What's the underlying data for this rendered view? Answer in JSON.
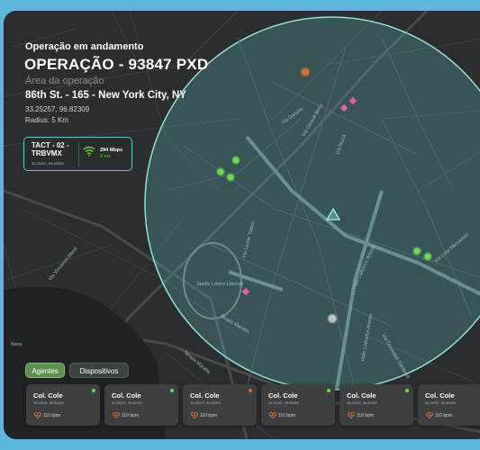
{
  "header": {
    "status": "Operação em andamento",
    "title": "OPERAÇÃO - 93847 PXD",
    "area_label": "Área da operação",
    "address": "86th St. - 165 - New York City, NY",
    "coordinates": "33.25257, 96.82309",
    "radius": "Radius: 5 Km"
  },
  "device": {
    "name": "TACT - 02 - TRBVMX",
    "coordinates": "33.25257, 96.82309",
    "speed": "294 Mbps",
    "ping": "3 ms",
    "icon": "wifi-icon"
  },
  "map": {
    "streets": [
      "Via Daniele",
      "Via Giosuè Borsi",
      "Via Nizza",
      "Via Leone Tolstoi",
      "Stadio Libero Liberati",
      "Strada Maratta",
      "Via Vincenzo Monti",
      "Viale Ludovico Ariosto",
      "Via Luigi Mercantini",
      "Via Giuseppe Garibaldi",
      "Strada Maratta",
      "Viale Ludovico Ariosto",
      "Nera"
    ],
    "colors": {
      "area": "#5fc6c4",
      "online": "#6bdb4d",
      "alert": "#e06a2a",
      "poi": "#e75ea8"
    }
  },
  "tabs": [
    {
      "label": "Agentes",
      "active": true
    },
    {
      "label": "Dispositivos",
      "active": false
    }
  ],
  "agents": [
    {
      "name": "Col. Cole",
      "coordinates": "33.25257, 96.82309",
      "bpm": "110 bpm",
      "status": "online"
    },
    {
      "name": "Col. Cole",
      "coordinates": "33.25257, 96.82309",
      "bpm": "110 bpm",
      "status": "online"
    },
    {
      "name": "Col. Cole",
      "coordinates": "33.25257, 96.82309",
      "bpm": "110 bpm",
      "status": "alert"
    },
    {
      "name": "Col. Cole",
      "coordinates": "33.25257, 96.82309",
      "bpm": "110 bpm",
      "status": "online"
    },
    {
      "name": "Col. Cole",
      "coordinates": "33.25257, 96.82309",
      "bpm": "110 bpm",
      "status": "online"
    },
    {
      "name": "Col. Cole",
      "coordinates": "33.25257, 96.82309",
      "bpm": "110 bpm",
      "status": "online"
    }
  ]
}
